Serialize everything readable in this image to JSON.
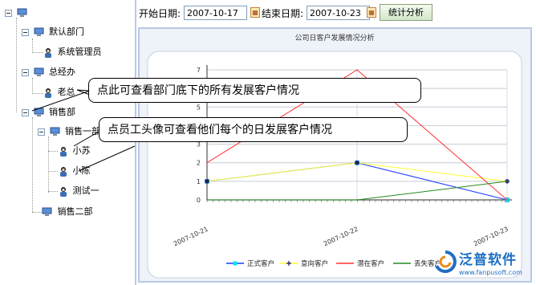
{
  "tree": {
    "root_label": "",
    "items": [
      {
        "label": "默认部门",
        "type": "dept"
      },
      {
        "label": "系统管理员",
        "type": "user"
      },
      {
        "label": "总经办",
        "type": "dept"
      },
      {
        "label": "老总",
        "type": "user"
      },
      {
        "label": "销售部",
        "type": "dept"
      },
      {
        "label": "销售一部",
        "type": "dept"
      },
      {
        "label": "小苏",
        "type": "user"
      },
      {
        "label": "小陈",
        "type": "user"
      },
      {
        "label": "测试一",
        "type": "user"
      },
      {
        "label": "销售二部",
        "type": "dept"
      }
    ]
  },
  "toolbar": {
    "start_label": "开始日期:",
    "start_value": "2007-10-17",
    "end_label": "结束日期:",
    "end_value": "2007-10-23",
    "stat_button": "统计分析"
  },
  "callouts": {
    "dept_tip": "点此可查看部门底下的所有发展客户情况",
    "user_tip": "点员工头像可查看他们每个的日发展客户情况"
  },
  "chart_data": {
    "type": "line",
    "title": "公司日客户发展情况分析",
    "categories": [
      "2007-10-21",
      "2007-10-22",
      "2007-10-23"
    ],
    "ylim": [
      0,
      7
    ],
    "yticks": [
      0,
      1,
      2,
      3,
      4,
      5,
      6,
      7
    ],
    "grid": true,
    "legend_position": "bottom",
    "series": [
      {
        "name": "正式客户",
        "values": [
          1,
          2,
          0
        ],
        "color": "#1e3cff",
        "marker": "cyan-square"
      },
      {
        "name": "意向客户",
        "values": [
          1,
          2,
          1
        ],
        "color": "#ffff33",
        "marker": "navy-star"
      },
      {
        "name": "潜在客户",
        "values": [
          2,
          7,
          0
        ],
        "color": "#ff3333",
        "marker": "none"
      },
      {
        "name": "丢失客户",
        "values": [
          0,
          0,
          1
        ],
        "color": "#228b22",
        "marker": "none"
      }
    ]
  },
  "watermark": {
    "brand": "泛普软件",
    "url": "www.fanpusoft.com"
  }
}
